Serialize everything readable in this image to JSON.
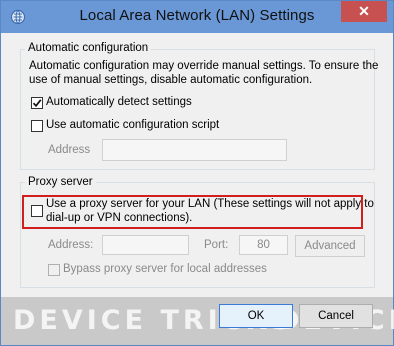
{
  "window": {
    "title": "Local Area Network (LAN) Settings",
    "close_label": "✕"
  },
  "auto_config": {
    "group_title": "Automatic configuration",
    "description_line1": "Automatic configuration may override manual settings.  To ensure the",
    "description_line2": "use of manual settings, disable automatic configuration.",
    "detect_label": "Automatically detect settings",
    "detect_checked": true,
    "script_label": "Use automatic configuration script",
    "script_checked": false,
    "address_label": "Address",
    "address_value": ""
  },
  "proxy": {
    "group_title": "Proxy server",
    "use_proxy_line1": "Use a proxy server for your LAN (These settings will not apply to",
    "use_proxy_line2": "dial-up or VPN connections).",
    "use_proxy_checked": false,
    "address_label": "Address:",
    "address_value": "",
    "port_label": "Port:",
    "port_value": "80",
    "advanced_label": "Advanced",
    "bypass_label": "Bypass proxy server for local addresses",
    "bypass_checked": false
  },
  "footer": {
    "ok_label": "OK",
    "cancel_label": "Cancel"
  },
  "watermark": {
    "text1": "DEVICE TRICKS",
    "text2": "DEVICE"
  },
  "colors": {
    "titlebar": "#6a98d6",
    "close": "#c75050",
    "highlight": "#d11f1f"
  }
}
